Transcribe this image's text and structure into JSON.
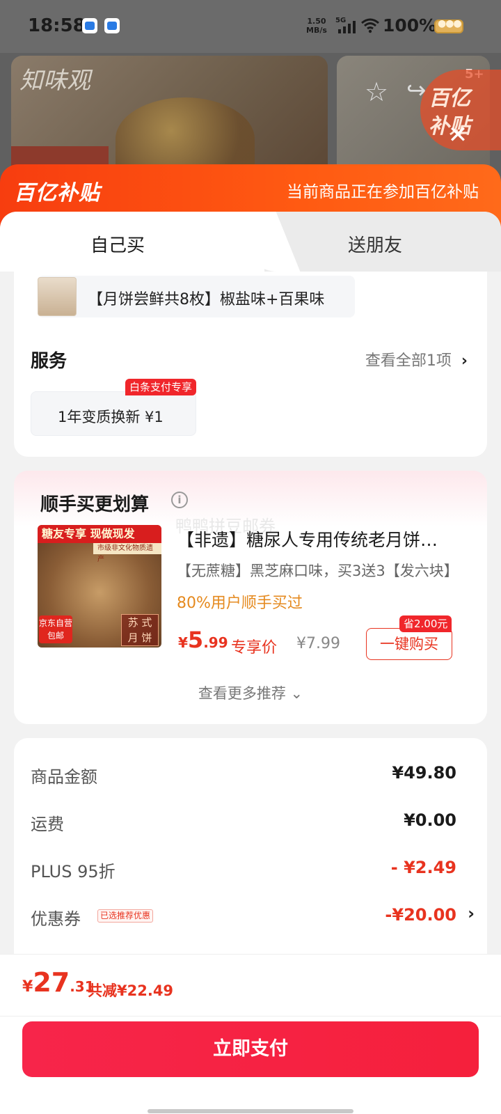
{
  "status_bar": {
    "time": "18:58",
    "net_speed": "1.50",
    "net_unit": "MB/s",
    "signal": "5G",
    "battery": "100%"
  },
  "backdrop": {
    "brand_text": "知味观",
    "badge_count": "5+",
    "subsidy_line1": "百亿",
    "subsidy_line2": "补贴"
  },
  "sheet_header": {
    "brand": "百亿补贴",
    "notice": "当前商品正在参加百亿补贴"
  },
  "tabs": {
    "self": "自己买",
    "friend": "送朋友"
  },
  "variant": {
    "text": "【月饼尝鲜共8枚】椒盐味+百果味"
  },
  "service": {
    "title": "服务",
    "view_all": "查看全部1项",
    "chip_label": "1年变质换新  ¥1",
    "chip_tag": "白条支付专享"
  },
  "recommend": {
    "title": "顺手买更划算",
    "watermark": "鸭鸭拼豆邮券",
    "image": {
      "top_band": "糖友专享  现做现发",
      "sub_band": "市级非文化物质遗产",
      "free_line1": "京东自营",
      "free_line2": "包邮",
      "stamp_line1": "苏 式",
      "stamp_line2": "月 饼"
    },
    "name": "【非遗】糖尿人专用传统老月饼…",
    "desc": "【无蔗糖】黑芝麻口味，买3送3【发六块】",
    "bought": "80%用户顺手买过",
    "price_yen": "¥",
    "price_int": "5",
    "price_dec": ".99",
    "price_label": "专享价",
    "orig_price": "¥7.99",
    "save_tag": "省2.00元",
    "buy_label": "一键购买",
    "more": "查看更多推荐 ⌄"
  },
  "summary": {
    "rows": [
      {
        "label": "商品金额",
        "value": "¥49.80"
      },
      {
        "label": "运费",
        "value": "¥0.00"
      },
      {
        "label": "PLUS 95折",
        "value": "- ¥2.49"
      },
      {
        "label": "优惠券",
        "value": "-¥20.00",
        "tag": "已选推荐优惠"
      }
    ]
  },
  "checkout": {
    "total_yen": "¥",
    "total_int": "27",
    "total_dec": ".31",
    "saved": "共减¥22.49",
    "pay_label": "立即支付"
  },
  "colors": {
    "accent_red": "#e8331f",
    "subsidy_orange": "#ff5a12",
    "pay_button": "#f5203c"
  }
}
